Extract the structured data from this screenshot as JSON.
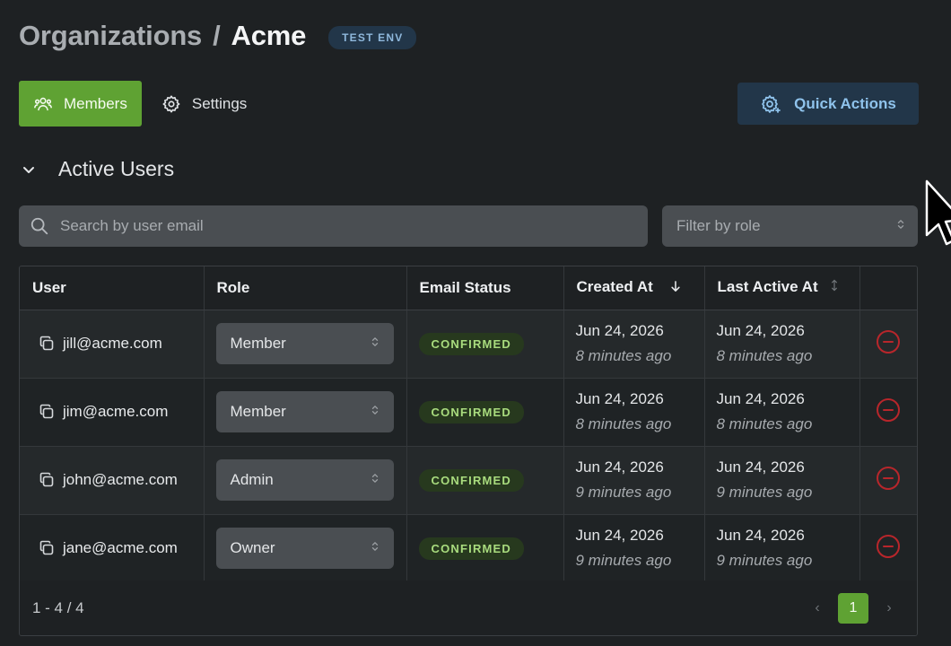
{
  "header": {
    "breadcrumb_parent": "Organizations",
    "breadcrumb_sep": "/",
    "breadcrumb_current": "Acme",
    "env_badge": "TEST ENV"
  },
  "tabs": [
    {
      "label": "Members",
      "icon": "users-icon",
      "active": true
    },
    {
      "label": "Settings",
      "icon": "gear-icon",
      "active": false
    }
  ],
  "quick_actions": {
    "label": "Quick Actions",
    "icon": "gear-sparkle-icon"
  },
  "section": {
    "title": "Active Users",
    "icon": "chevron-down-icon"
  },
  "search": {
    "placeholder": "Search by user email",
    "value": "",
    "icon": "search-icon"
  },
  "filter": {
    "placeholder": "Filter by role",
    "icon": "updown-icon"
  },
  "table": {
    "columns": [
      "User",
      "Role",
      "Email Status",
      "Created At",
      "Last Active At",
      ""
    ],
    "rows": [
      {
        "email": "jill@acme.com",
        "role": "Member",
        "status": "CONFIRMED",
        "created": "Jun 24, 2026",
        "created_rel": "8 minutes ago",
        "active": "Jun 24, 2026",
        "active_rel": "8 minutes ago"
      },
      {
        "email": "jim@acme.com",
        "role": "Member",
        "status": "CONFIRMED",
        "created": "Jun 24, 2026",
        "created_rel": "8 minutes ago",
        "active": "Jun 24, 2026",
        "active_rel": "8 minutes ago"
      },
      {
        "email": "john@acme.com",
        "role": "Admin",
        "status": "CONFIRMED",
        "created": "Jun 24, 2026",
        "created_rel": "9 minutes ago",
        "active": "Jun 24, 2026",
        "active_rel": "9 minutes ago"
      },
      {
        "email": "jane@acme.com",
        "role": "Owner",
        "status": "CONFIRMED",
        "created": "Jun 24, 2026",
        "created_rel": "9 minutes ago",
        "active": "Jun 24, 2026",
        "active_rel": "9 minutes ago"
      }
    ]
  },
  "pagination": {
    "summary": "1 - 4 / 4",
    "current_page": "1",
    "prev": "‹",
    "next": "›"
  },
  "colors": {
    "accent_green": "#5fa233",
    "badge_blue_bg": "#223649",
    "remove_red": "#c0392b"
  }
}
